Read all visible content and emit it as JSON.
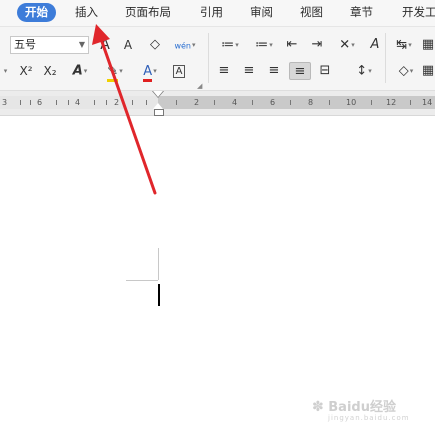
{
  "menu": {
    "tabs": [
      {
        "label": "开始",
        "active": true
      },
      {
        "label": "插入"
      },
      {
        "label": "页面布局"
      },
      {
        "label": "引用"
      },
      {
        "label": "审阅"
      },
      {
        "label": "视图"
      },
      {
        "label": "章节"
      },
      {
        "label": "开发工"
      }
    ]
  },
  "ribbon": {
    "font_size_value": "五号",
    "buttons": {
      "grow_font": "A",
      "shrink_font": "A",
      "clear_format": "◇",
      "phonetic": "wén",
      "bullets": "≔",
      "numbering": "≔",
      "outdent": "⇤",
      "indent": "⇥",
      "chinese_layout": "✕",
      "text_direction": "A",
      "sort": "↹",
      "superscript": "X²",
      "subscript": "X₂",
      "text_effect": "A",
      "highlight": "✎",
      "font_color": "A",
      "char_border": "A",
      "align_left": "≡",
      "align_center": "≡",
      "align_right": "≡",
      "justify": "≡",
      "distributed": "⊟",
      "line_spacing": "↕",
      "shading": "◇",
      "borders": "▦"
    }
  },
  "ruler": {
    "numbers": [
      "3",
      "6",
      "4",
      "2",
      "2",
      "4",
      "6",
      "8",
      "10",
      "12",
      "14"
    ]
  },
  "colors": {
    "active_tab": "#3d7cd9",
    "annotation_arrow": "#e0262b",
    "font_color_underline": "#e02020",
    "highlight_underline": "#f0d000"
  },
  "watermark": {
    "brand": "Baidu经验",
    "sub": "jingyan.baidu.com"
  }
}
